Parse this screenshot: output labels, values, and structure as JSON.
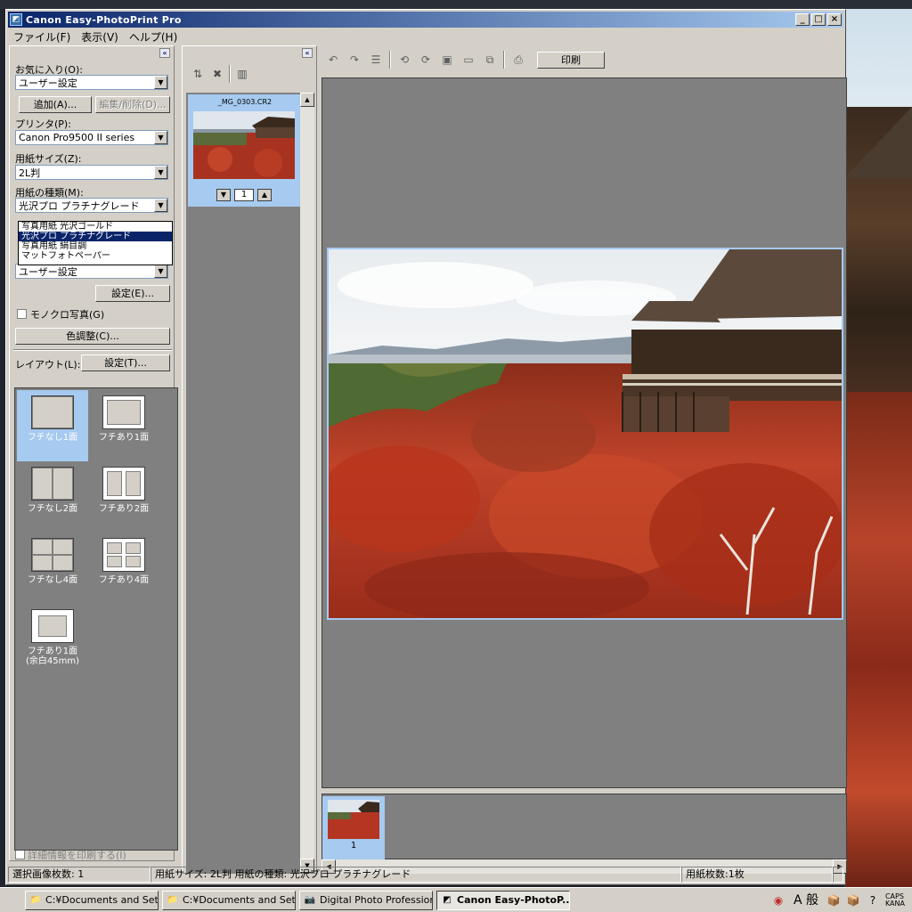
{
  "window": {
    "title": "Canon Easy-PhotoPrint Pro",
    "controls": {
      "minimize": "_",
      "maximize": "□",
      "close": "×"
    }
  },
  "menu": [
    "ファイル(F)",
    "表示(V)",
    "ヘルプ(H)"
  ],
  "left": {
    "favorites_label": "お気に入り(O):",
    "favorites_value": "ユーザー設定",
    "add_button": "追加(A)...",
    "edit_button": "編集/削除(D)...",
    "printer_label": "プリンタ(P):",
    "printer_value": "Canon Pro9500 II series",
    "paper_size_label": "用紙サイズ(Z):",
    "paper_size_value": "2L判",
    "paper_type_label": "用紙の種類(M):",
    "paper_type_value": "光沢プロ プラチナグレード",
    "paper_type_options": [
      "写真用紙 光沢ゴールド",
      "光沢プロ プラチナグレード",
      "写真用紙 絹目調",
      "マットフォトペーパー"
    ],
    "quality_value": "ユーザー設定",
    "settings_button": "設定(E)...",
    "mono_label": "モノクロ写真(G)",
    "color_adjust_button": "色調整(C)...",
    "layout_label": "レイアウト(L):",
    "layout_settings_button": "設定(T)...",
    "layouts": [
      "フチなし1面",
      "フチあり1面",
      "フチなし2面",
      "フチあり2面",
      "フチなし4面",
      "フチあり4面",
      "フチあり1面\n(余白45mm)"
    ],
    "print_details_label": "詳細情報を印刷する(I)"
  },
  "thumbnails": {
    "file_name": "_MG_0303.CR2",
    "copies": "1"
  },
  "toolbar": {
    "print_button": "印刷"
  },
  "filmstrip": {
    "page_number": "1"
  },
  "status": {
    "selected_count": "選択画像枚数: 1",
    "paper_info": "用紙サイズ: 2L判  用紙の種類: 光沢プロ プラチナグレード",
    "sheet_count": "用紙枚数:1枚"
  },
  "taskbar": {
    "tasks": [
      "C:¥Documents and Setti...",
      "C:¥Documents and Setti...",
      "Digital Photo Profession...",
      "Canon Easy-PhotoP..."
    ],
    "ime_main": "A 般",
    "ime_caps": "CAPS",
    "ime_kana": "KANA"
  }
}
